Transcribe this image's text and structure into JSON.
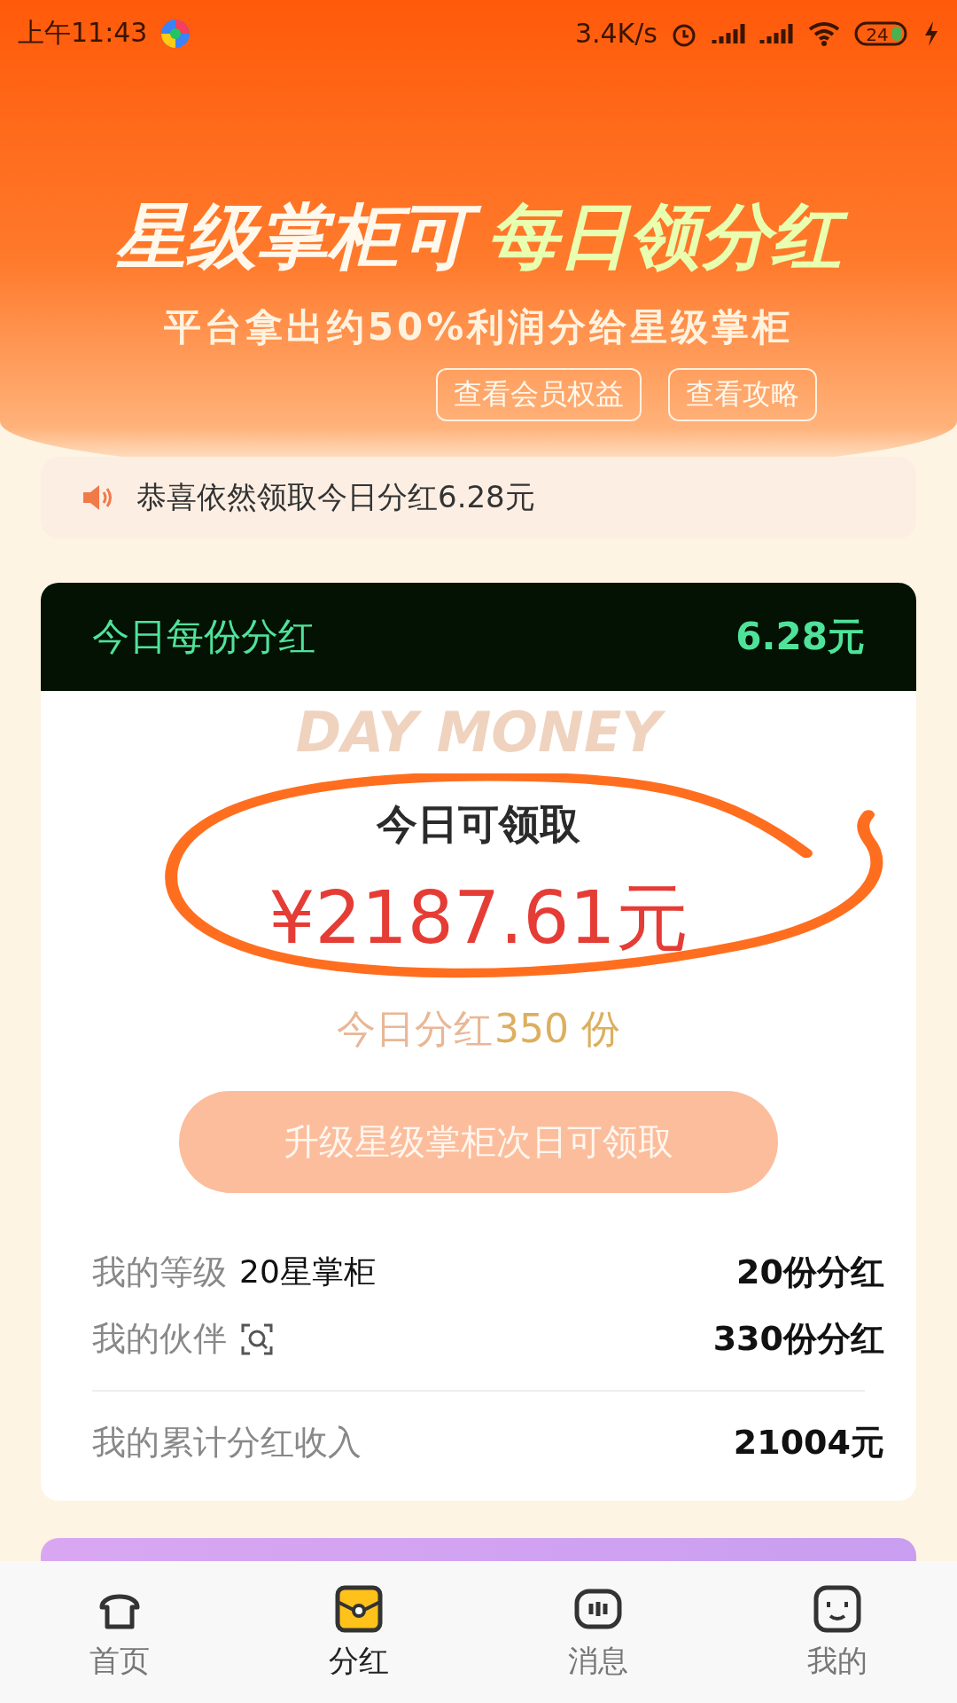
{
  "status_bar": {
    "time": "上午11:43",
    "speed": "3.4K/s",
    "battery": "24"
  },
  "header": {
    "title_white": "星级掌柜可",
    "title_gold": "每日领分红",
    "subtitle": "平台拿出约50%利润分给星级掌柜",
    "buttons": [
      "查看会员权益",
      "查看攻略"
    ]
  },
  "notice": {
    "text": "恭喜依然领取今日分红6.28元"
  },
  "card": {
    "header_label": "今日每份分红",
    "header_value": "6.28元",
    "watermark": "DAY MONEY",
    "claim_label": "今日可领取",
    "amount": "¥2187.61元",
    "shares_label": "今日分红",
    "shares_value": "350 份",
    "action": "升级星级掌柜次日可领取",
    "stats": [
      {
        "kind": "level",
        "label": "我的等级",
        "detail": "20星掌柜",
        "value": "20份分红"
      },
      {
        "kind": "partner",
        "label": "我的伙伴",
        "value": "330份分红"
      }
    ],
    "total": {
      "label": "我的累计分红收入",
      "value": "21004元"
    }
  },
  "nav": [
    {
      "label": "首页",
      "selected": false
    },
    {
      "label": "分红",
      "selected": true
    },
    {
      "label": "消息",
      "selected": false
    },
    {
      "label": "我的",
      "selected": false
    }
  ]
}
